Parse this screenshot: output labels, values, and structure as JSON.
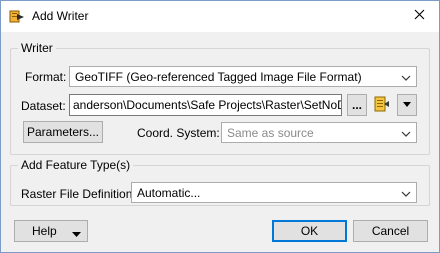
{
  "window": {
    "title": "Add Writer",
    "icon": "writer-add-icon",
    "close_icon": "close-icon"
  },
  "writer": {
    "legend": "Writer",
    "format_label": "Format:",
    "format_value": "GeoTIFF (Geo-referenced Tagged Image File Format)",
    "dataset_label": "Dataset:",
    "dataset_value": "anderson\\Documents\\Safe Projects\\Raster\\SetNoData\"",
    "browse_label": "...",
    "parameters_label": "Parameters...",
    "coord_label": "Coord. System:",
    "coord_value": "Same as source"
  },
  "feature_types": {
    "legend": "Add Feature Type(s)",
    "raster_label": "Raster File Definition:",
    "raster_value": "Automatic..."
  },
  "footer": {
    "help_label": "Help",
    "ok_label": "OK",
    "cancel_label": "Cancel"
  },
  "colors": {
    "accent": "#0078d7",
    "window_bg": "#f0f0f0"
  }
}
